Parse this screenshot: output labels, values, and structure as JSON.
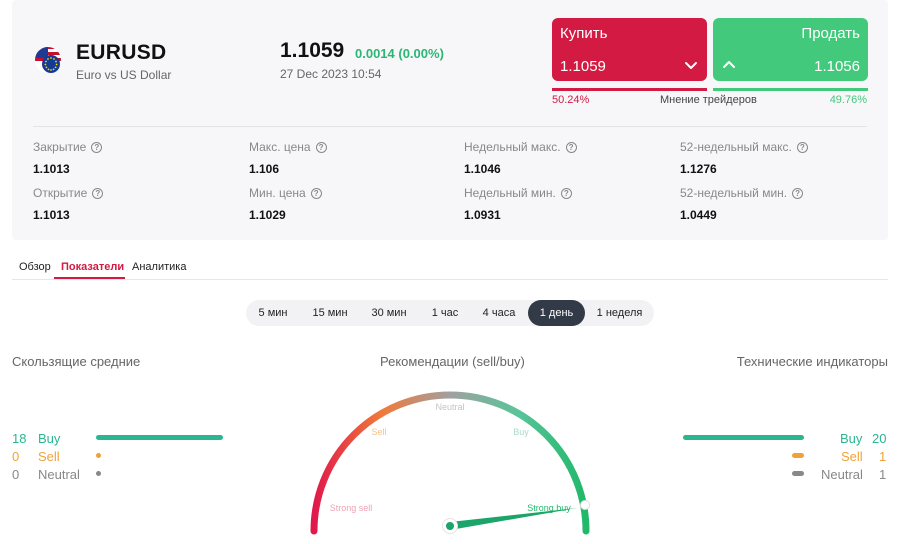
{
  "instrument": {
    "symbol": "EURUSD",
    "description": "Euro vs US Dollar",
    "price": "1.1059",
    "change": "0.0014 (0.00%)",
    "timestamp": "27 Dec 2023 10:54"
  },
  "trade": {
    "buy_label": "Купить",
    "buy_price": "1.1059",
    "sell_label": "Продать",
    "sell_price": "1.1056"
  },
  "sentiment": {
    "buy_pct": "50.24%",
    "title": "Мнение трейдеров",
    "sell_pct": "49.76%"
  },
  "stats": {
    "close_label": "Закрытие",
    "close_value": "1.1013",
    "max_label": "Макс. цена",
    "max_value": "1.106",
    "week_max_label": "Недельный макс.",
    "week_max_value": "1.1046",
    "y52_max_label": "52-недельный макс.",
    "y52_max_value": "1.1276",
    "open_label": "Открытие",
    "open_value": "1.1013",
    "min_label": "Мин. цена",
    "min_value": "1.1029",
    "week_min_label": "Недельный мин.",
    "week_min_value": "1.0931",
    "y52_min_label": "52-недельный мин.",
    "y52_min_value": "1.0449"
  },
  "tabs": [
    "Обзор",
    "Показатели",
    "Аналитика"
  ],
  "active_tab": "Показатели",
  "timeframes": [
    "5 мин",
    "15 мин",
    "30 мин",
    "1 час",
    "4 часа",
    "1 день",
    "1 неделя"
  ],
  "active_timeframe": "1 день",
  "moving_averages": {
    "title": "Скользящие средние",
    "buy_count": "18",
    "buy_label": "Buy",
    "sell_count": "0",
    "sell_label": "Sell",
    "neutral_count": "0",
    "neutral_label": "Neutral"
  },
  "recommendation": {
    "title": "Рекомендации (sell/buy)",
    "labels": {
      "neutral": "Neutral",
      "sell": "Sell",
      "buy": "Buy",
      "strong_sell": "Strong sell",
      "strong_buy": "Strong buy"
    }
  },
  "technical_indicators": {
    "title": "Технические индикаторы",
    "buy_label": "Buy",
    "buy_count": "20",
    "sell_label": "Sell",
    "sell_count": "1",
    "neutral_label": "Neutral",
    "neutral_count": "1"
  },
  "colors": {
    "buy": "#d31a42",
    "sell": "#42c97b",
    "indicator_buy": "#2bb68f",
    "indicator_sell": "#f0a23a",
    "indicator_neutral": "#888888",
    "active_dark": "#333a47"
  }
}
